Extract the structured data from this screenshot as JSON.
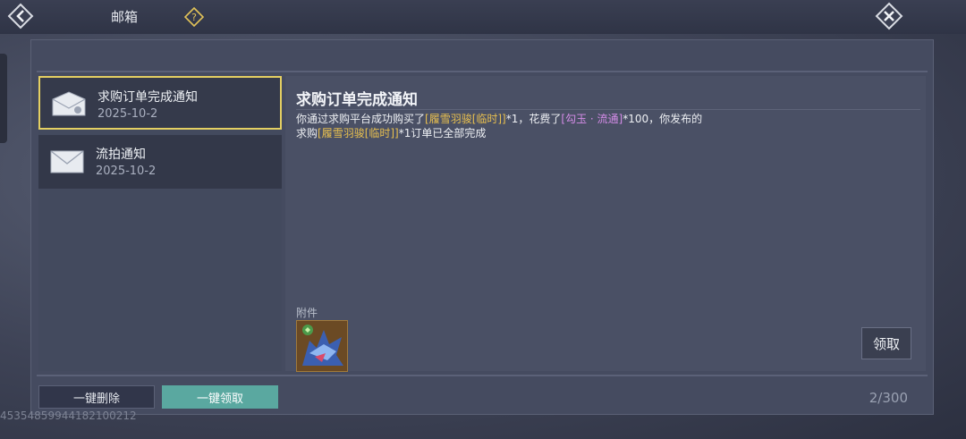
{
  "header": {
    "title": "邮箱",
    "help_icon": "question-icon",
    "back_icon": "back-arrow-icon",
    "close_icon": "close-icon"
  },
  "mail_list": [
    {
      "subject": "求购订单完成通知",
      "date": "2025-10-2",
      "selected": true,
      "icon": "envelope-opened-icon"
    },
    {
      "subject": "流拍通知",
      "date": "2025-10-2",
      "selected": false,
      "icon": "envelope-icon"
    }
  ],
  "detail": {
    "title": "求购订单完成通知",
    "body": {
      "line1_a": "你通过求购平台成功购买了",
      "line1_item": "[履雪羽骏[临时]]",
      "line1_b": "*1，花费了",
      "line1_currency": "[勾玉 · 流通]",
      "line1_c": "*100，你发布的",
      "line2_a": "求购",
      "line2_item": "[履雪羽骏[临时]]",
      "line2_b": "*1订单已全部完成"
    },
    "attachment_label": "附件",
    "attachment_icon": "wolf-mount-icon",
    "claim_label": "领取"
  },
  "footer": {
    "delete_all_label": "一键删除",
    "claim_all_label": "一键领取",
    "count": "2/300"
  },
  "uid": "4535485994418210021​2",
  "colors": {
    "selected_border": "#e4cf62",
    "item_highlight": "#e9c04f",
    "currency_highlight": "#d58ce8",
    "claim_all_bg": "#5aa8a0"
  }
}
